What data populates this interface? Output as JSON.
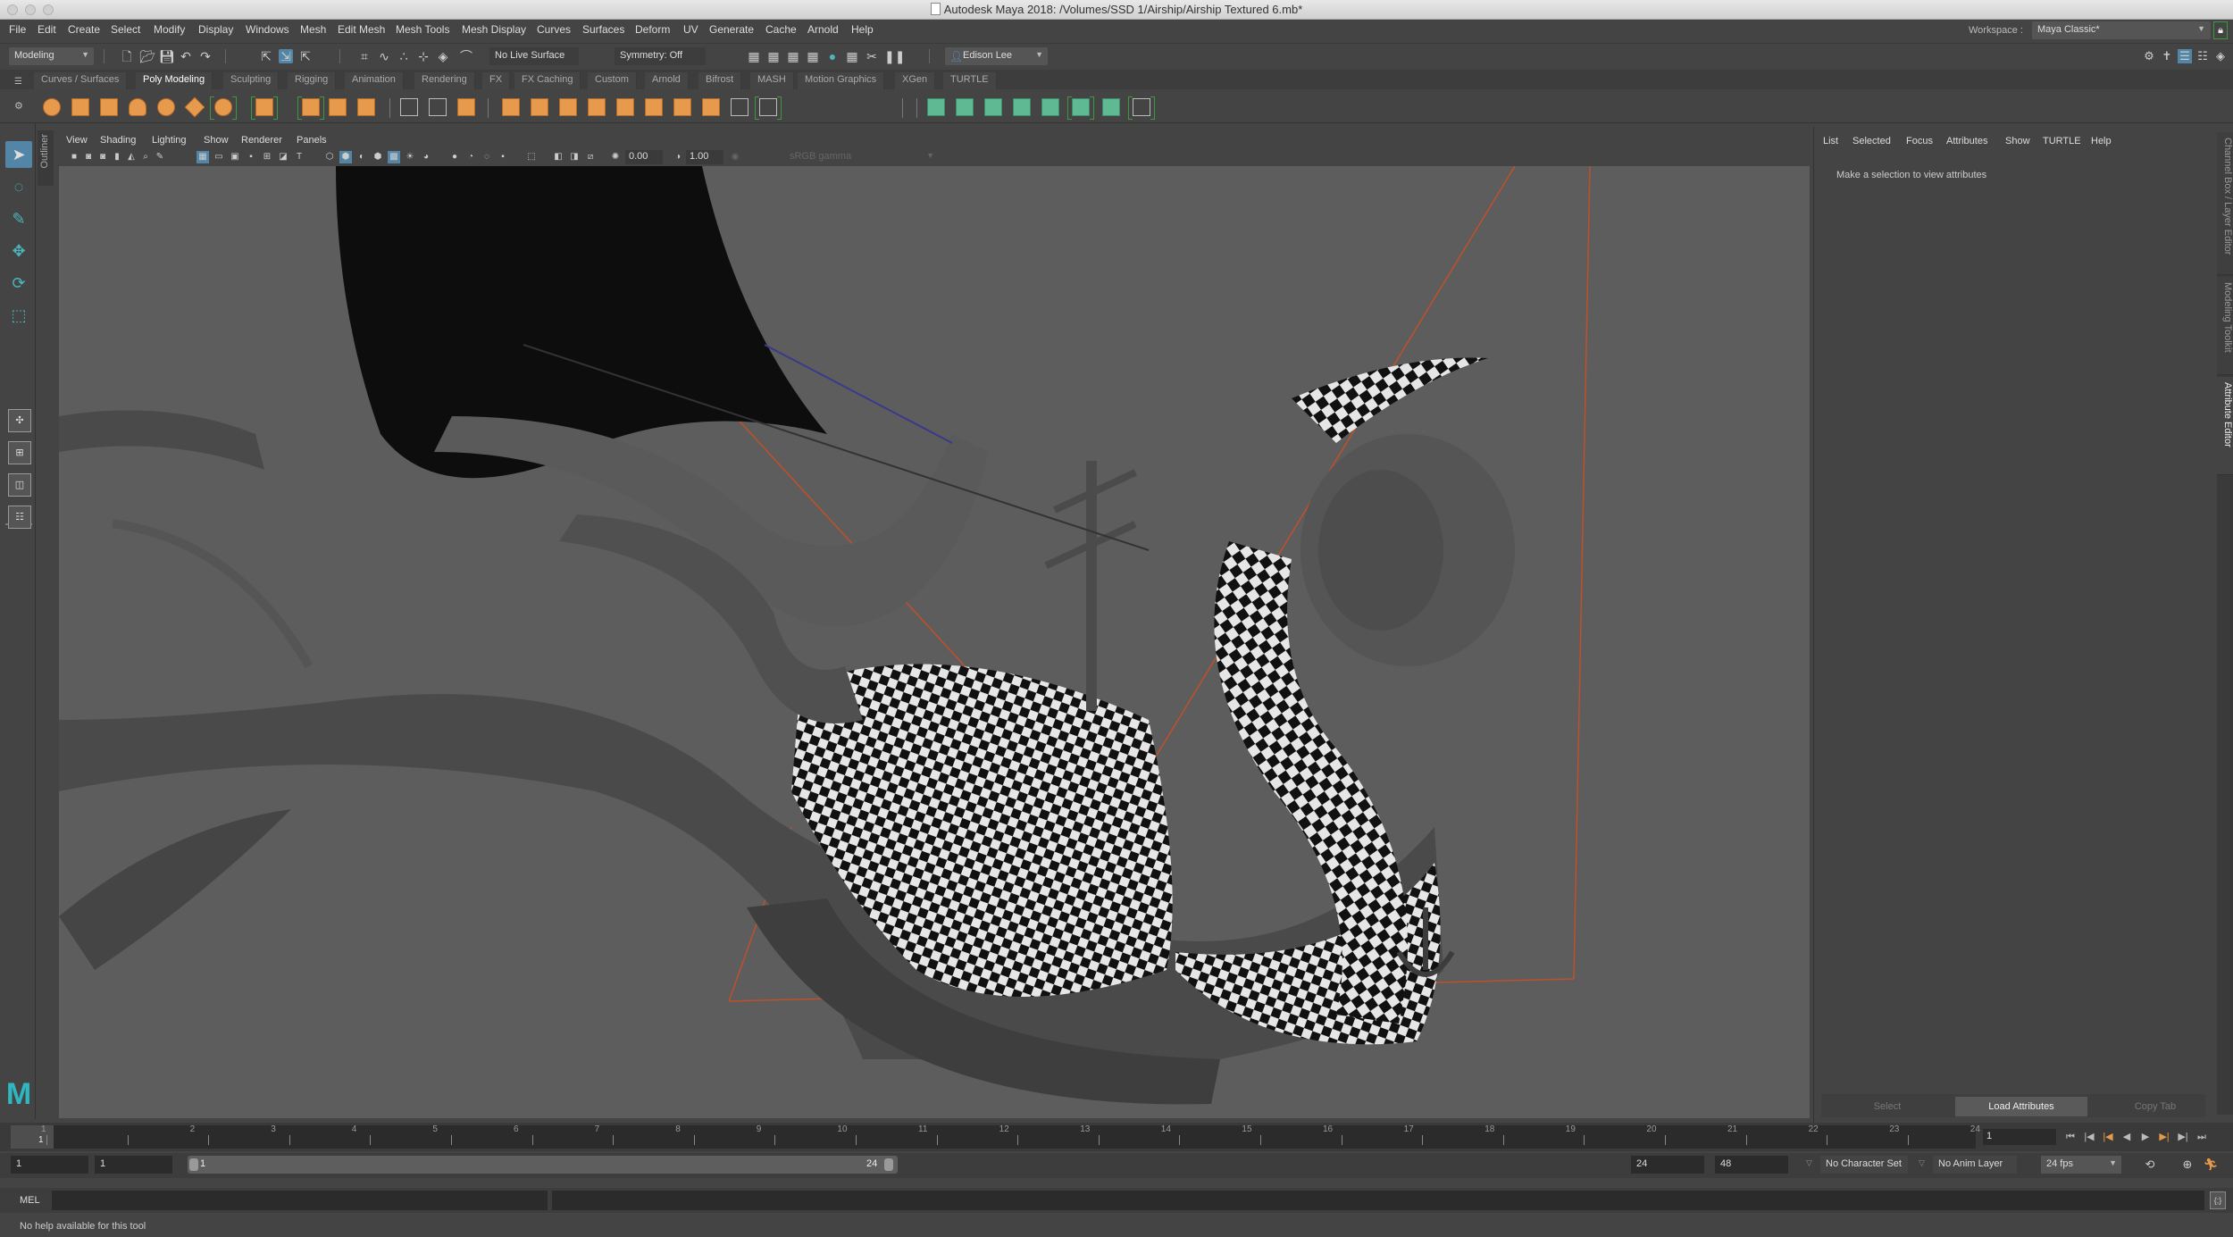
{
  "window": {
    "title": "Autodesk Maya 2018: /Volumes/SSD 1/Airship/Airship Textured 6.mb*"
  },
  "menubar": {
    "items": [
      "File",
      "Edit",
      "Create",
      "Select",
      "Modify",
      "Display",
      "Windows",
      "Mesh",
      "Edit Mesh",
      "Mesh Tools",
      "Mesh Display",
      "Curves",
      "Surfaces",
      "Deform",
      "UV",
      "Generate",
      "Cache",
      "Arnold",
      "Help"
    ],
    "workspace_label": "Workspace :",
    "workspace_value": "Maya Classic*"
  },
  "statusline": {
    "mode": "Modeling",
    "live_surface": "No Live Surface",
    "symmetry": "Symmetry: Off",
    "user": "Edison Lee"
  },
  "shelf": {
    "tabs": [
      "Curves / Surfaces",
      "Poly Modeling",
      "Sculpting",
      "Rigging",
      "Animation",
      "Rendering",
      "FX",
      "FX Caching",
      "Custom",
      "Arnold",
      "Bifrost",
      "MASH",
      "Motion Graphics",
      "XGen",
      "TURTLE"
    ],
    "active_tab": "Poly Modeling",
    "icons": [
      {
        "name": "poly-sphere-icon",
        "color": "orange"
      },
      {
        "name": "poly-cube-icon",
        "color": "orange"
      },
      {
        "name": "poly-cylinder-icon",
        "color": "orange"
      },
      {
        "name": "poly-cone-icon",
        "color": "orange"
      },
      {
        "name": "poly-torus-icon",
        "color": "orange"
      },
      {
        "name": "poly-plane-icon",
        "color": "orange"
      },
      {
        "name": "poly-disc-icon",
        "color": "orange"
      },
      {
        "name": "platonic-solid-icon",
        "color": "orange"
      },
      {
        "name": "super-shape-icon",
        "color": "orange"
      },
      {
        "name": "type-icon",
        "color": "orange"
      },
      {
        "name": "svg-icon",
        "color": "orange"
      },
      {
        "name": "mirror-icon",
        "color": "grey"
      },
      {
        "name": "smooth-icon",
        "color": "grey"
      },
      {
        "name": "combine-icon",
        "color": "orange"
      },
      {
        "name": "separate-icon",
        "color": "orange"
      },
      {
        "name": "extract-icon",
        "color": "orange"
      },
      {
        "name": "booleans-icon",
        "color": "orange"
      },
      {
        "name": "bridge-icon",
        "color": "orange"
      },
      {
        "name": "extrude-icon",
        "color": "orange"
      },
      {
        "name": "bevel-icon",
        "color": "orange"
      },
      {
        "name": "fill-hole-icon",
        "color": "orange"
      },
      {
        "name": "target-weld-icon",
        "color": "orange"
      },
      {
        "name": "multi-cut-icon",
        "color": "grey"
      },
      {
        "name": "quad-draw-icon",
        "color": "grey"
      },
      {
        "name": "planar-uv-icon",
        "color": "teal"
      },
      {
        "name": "cylindrical-uv-icon",
        "color": "teal"
      },
      {
        "name": "spherical-uv-icon",
        "color": "teal"
      },
      {
        "name": "automatic-uv-icon",
        "color": "teal"
      },
      {
        "name": "contour-stretch-icon",
        "color": "teal"
      },
      {
        "name": "uv-editor-icon",
        "color": "teal"
      },
      {
        "name": "unfold-icon",
        "color": "teal"
      },
      {
        "name": "cut-sew-icon",
        "color": "grey"
      }
    ]
  },
  "panel": {
    "menu": [
      "View",
      "Shading",
      "Lighting",
      "Show",
      "Renderer",
      "Panels"
    ],
    "exposure": "0.00",
    "gamma": "1.00",
    "color_space": "sRGB gamma"
  },
  "outliner_tab": "Outliner",
  "attribute_editor": {
    "menu": [
      "List",
      "Selected",
      "Focus",
      "Attributes",
      "Show",
      "TURTLE",
      "Help"
    ],
    "hint": "Make a selection to view attributes",
    "buttons": [
      "Select",
      "Load Attributes",
      "Copy Tab"
    ]
  },
  "side_tabs": [
    "Channel Box / Layer Editor",
    "Modeling Toolkit",
    "Attribute Editor"
  ],
  "timeline": {
    "ticks": [
      "1",
      "2",
      "3",
      "4",
      "5",
      "6",
      "7",
      "8",
      "9",
      "10",
      "11",
      "12",
      "13",
      "14",
      "15",
      "16",
      "17",
      "18",
      "19",
      "20",
      "21",
      "22",
      "23",
      "24"
    ],
    "current_frame": "1",
    "current_frame_field": "1",
    "range_start": "1",
    "playback_start": "1",
    "range_bar_start": "1",
    "range_bar_end": "24",
    "playback_end": "24",
    "range_end": "48",
    "character_set": "No Character Set",
    "anim_layer": "No Anim Layer",
    "fps": "24 fps"
  },
  "cmdline": {
    "label": "MEL",
    "value": ""
  },
  "helpline": {
    "text": "No help available for this tool"
  },
  "colors": {
    "accent": "#5285a6",
    "shelf_orange": "#e89a4c",
    "shelf_teal": "#5fba94",
    "camera_frustum": "#c0502a",
    "maya_logo": "#2fb6c0"
  }
}
